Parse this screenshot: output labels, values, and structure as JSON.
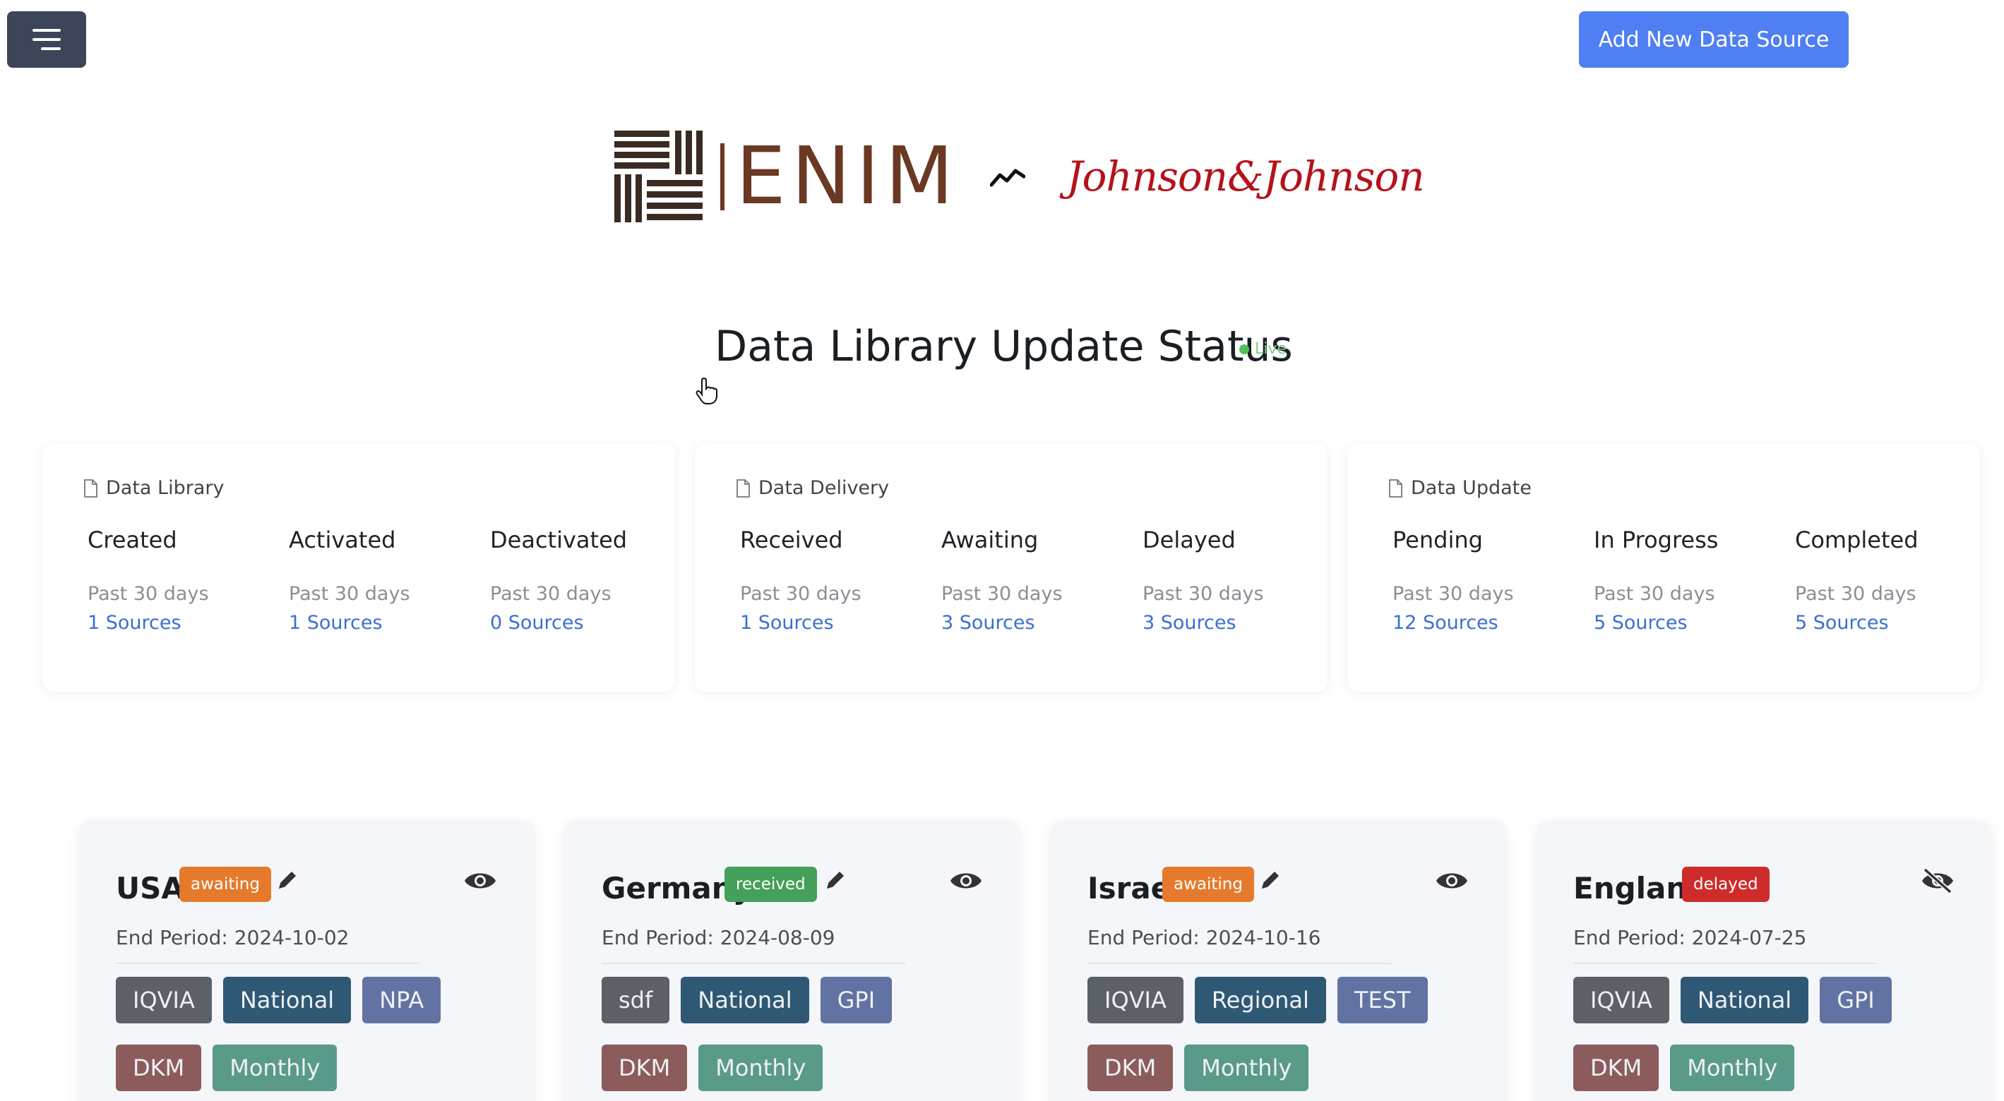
{
  "header": {
    "menu_icon": "hamburger-icon",
    "add_button_label": "Add New Data Source"
  },
  "logos": {
    "enim_text": "ENIM",
    "partner_text": "Johnson&Johnson",
    "separator_icon": "trend-line-icon"
  },
  "title": {
    "text": "Data Library Update Status",
    "live_label": "Live"
  },
  "stats": [
    {
      "heading": "Data Library",
      "columns": [
        {
          "title": "Created",
          "period": "Past 30 days",
          "count": "1 Sources"
        },
        {
          "title": "Activated",
          "period": "Past 30 days",
          "count": "1 Sources"
        },
        {
          "title": "Deactivated",
          "period": "Past 30 days",
          "count": "0 Sources"
        }
      ]
    },
    {
      "heading": "Data Delivery",
      "columns": [
        {
          "title": "Received",
          "period": "Past 30 days",
          "count": "1 Sources"
        },
        {
          "title": "Awaiting",
          "period": "Past 30 days",
          "count": "3 Sources"
        },
        {
          "title": "Delayed",
          "period": "Past 30 days",
          "count": "3 Sources"
        }
      ]
    },
    {
      "heading": "Data Update",
      "columns": [
        {
          "title": "Pending",
          "period": "Past 30 days",
          "count": "12 Sources"
        },
        {
          "title": "In Progress",
          "period": "Past 30 days",
          "count": "5 Sources"
        },
        {
          "title": "Completed",
          "period": "Past 30 days",
          "count": "5 Sources"
        }
      ]
    }
  ],
  "countries": [
    {
      "name": "USA",
      "status": "awaiting",
      "end_period": "End Period: 2024-10-02",
      "tags_row1": [
        "IQVIA",
        "National",
        "NPA"
      ],
      "tags_row2": [
        "DKM",
        "Monthly"
      ],
      "eye_icon": "eye-icon"
    },
    {
      "name": "Germany",
      "status": "received",
      "end_period": "End Period: 2024-08-09",
      "tags_row1": [
        "sdf",
        "National",
        "GPI"
      ],
      "tags_row2": [
        "DKM",
        "Monthly"
      ],
      "eye_icon": "eye-icon"
    },
    {
      "name": "Israel",
      "status": "awaiting",
      "end_period": "End Period: 2024-10-16",
      "tags_row1": [
        "IQVIA",
        "Regional",
        "TEST"
      ],
      "tags_row2": [
        "DKM",
        "Monthly"
      ],
      "eye_icon": "eye-icon"
    },
    {
      "name": "England",
      "status": "delayed",
      "end_period": "End Period: 2024-07-25",
      "tags_row1": [
        "IQVIA",
        "National",
        "GPI"
      ],
      "tags_row2": [
        "DKM",
        "Monthly"
      ],
      "eye_icon": "eye-slash-icon"
    }
  ],
  "colors": {
    "accent": "#4f7ff3",
    "awaiting": "#e57a2c",
    "received": "#44a05a",
    "delayed": "#cf2b2b",
    "link": "#3b6fd1"
  }
}
